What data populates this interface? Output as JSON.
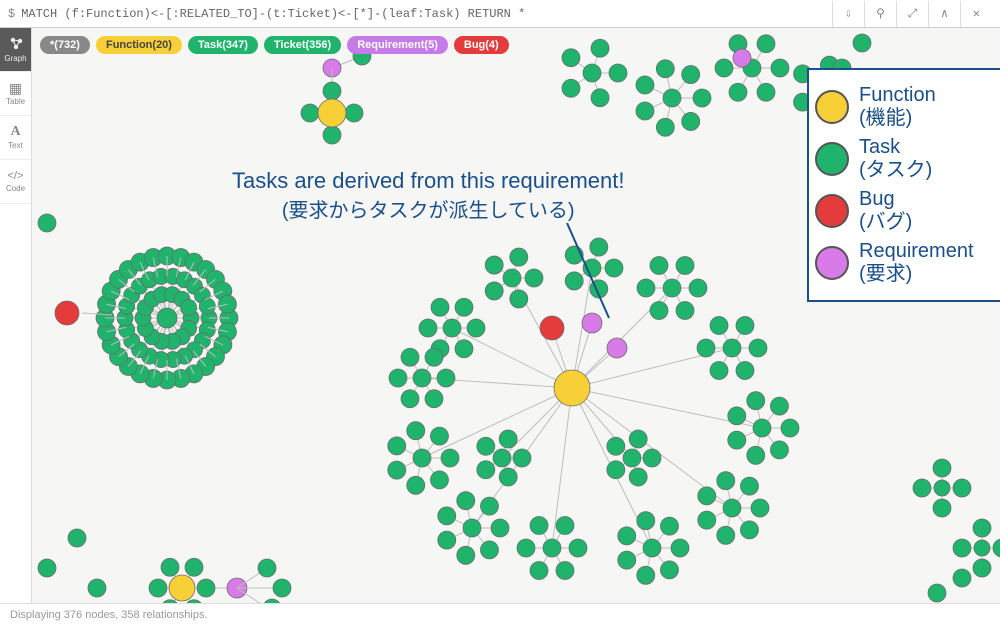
{
  "query": {
    "prompt": "$",
    "text": "MATCH (f:Function)<-[:RELATED_TO]-(t:Ticket)<-[*]-(leaf:Task) RETURN *"
  },
  "sidebar": {
    "items": [
      {
        "icon": "◐",
        "label": "Graph"
      },
      {
        "icon": "▦",
        "label": "Table"
      },
      {
        "icon": "A",
        "label": "Text"
      },
      {
        "icon": "</>",
        "label": "Code"
      }
    ]
  },
  "pills": [
    {
      "cls": "gray",
      "label": "*(732)"
    },
    {
      "cls": "yellow",
      "label": "Function(20)"
    },
    {
      "cls": "green",
      "label": "Task(347)"
    },
    {
      "cls": "green2",
      "label": "Ticket(356)"
    },
    {
      "cls": "purple",
      "label": "Requirement(5)"
    },
    {
      "cls": "red",
      "label": "Bug(4)"
    }
  ],
  "annotation": {
    "line1": "Tasks are derived from this requirement!",
    "line2": "(要求からタスクが派生している)"
  },
  "legend": {
    "items": [
      {
        "cls": "ly",
        "en": "Function",
        "jp": "(機能)"
      },
      {
        "cls": "lg",
        "en": "Task",
        "jp": "(タスク)"
      },
      {
        "cls": "lr",
        "en": "Bug",
        "jp": "(バグ)"
      },
      {
        "cls": "lp",
        "en": "Requirement",
        "jp": "(要求)"
      }
    ]
  },
  "status": {
    "text": "Displaying 376 nodes, 358 relationships."
  },
  "colors": {
    "green": "#1fb36b",
    "yellow": "#f7d038",
    "red": "#e43c3c",
    "purple": "#d87ae8",
    "edge": "#bdbdbd"
  }
}
